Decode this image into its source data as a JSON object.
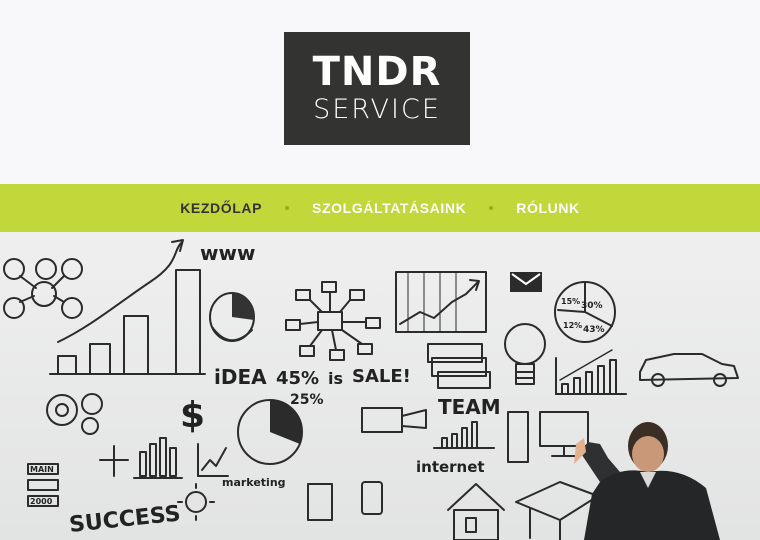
{
  "logo": {
    "line1": "TNDR",
    "line2": "SERVICE"
  },
  "nav": {
    "items": [
      {
        "label": "KEZDŐLAP",
        "active": true
      },
      {
        "label": "SZOLGÁLTATÁSAINK",
        "active": false
      },
      {
        "label": "RÓLUNK",
        "active": false
      }
    ]
  },
  "hero": {
    "sketch_words": [
      "www",
      "iDEA",
      "45%",
      "is",
      "SALE!",
      "25%",
      "TEAM",
      "internet",
      "marketing",
      "SUCCESS",
      "MAIN",
      "2000",
      "30%",
      "15%",
      "12%",
      "43%"
    ]
  },
  "colors": {
    "accent": "#c1d73a",
    "logo_bg": "#333432",
    "page_bg": "#f8f8fa"
  }
}
